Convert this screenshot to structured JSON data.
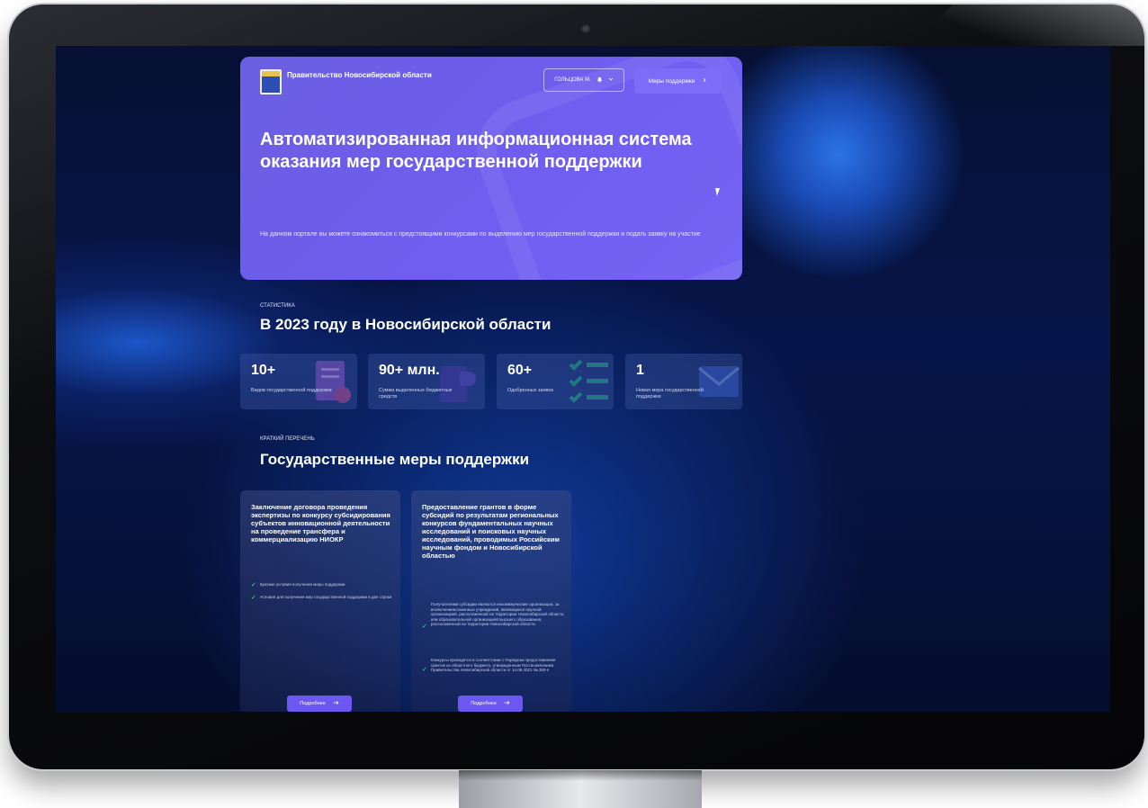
{
  "header": {
    "org_name": "Правительство Новосибирской области",
    "user_label": "ГОЛЬЦОВА М.",
    "measures_button": "Меры поддержки"
  },
  "hero": {
    "title": "Автоматизированная информационная система оказания мер государственной поддержки",
    "description": "На данном портале вы можете ознакомиться с предстоящими конкурсами по выделению мер государственной поддержки и подать заявку на участие"
  },
  "statistics": {
    "kicker": "СТАТИСТИКА",
    "title": "В 2023 году в Новосибирской области",
    "items": [
      {
        "value": "10+",
        "label": "Видов государственной поддержки"
      },
      {
        "value": "90+ млн.",
        "label": "Сумма выделенных бюджетных средств"
      },
      {
        "value": "60+",
        "label": "Одобренных заявок"
      },
      {
        "value": "1",
        "label": "Новая мера государственной поддержки"
      }
    ]
  },
  "measures": {
    "kicker": "КРАТКИЙ ПЕРЕЧЕНЬ",
    "title": "Государственные меры поддержки",
    "cards": [
      {
        "title": "Заключение договора проведения экспертизы по конкурсу субсидирования субъектов инновационной деятельности на проведение трансфера и коммерциализацию НИОКР",
        "items": [
          "Краткие условия получения меры поддержки",
          "Условия для получения мер государственной поддержки в две строки"
        ],
        "button": "Подробнее"
      },
      {
        "title": "Предоставление грантов в форме субсидий по результатам региональных конкурсов фундаментальных научных исследований и поисковых научных исследований, проводимых Российским научным фондом и Новосибирской областью",
        "items": [
          "Получателями субсидии являются некоммерческие организации, за исключением казенных учреждений, являющиеся научной организацией, расположенной на территории Новосибирской области, или образовательной организацией высшего образования, расположенной на территории Новосибирской области",
          "Конкурсы проводятся в соответствии с Порядком предоставления грантов из областного бюджета, утвержденным Постановлением Правительства Новосибирской области от 14.09.2021 № 350-п"
        ],
        "button": "Подробнее"
      }
    ]
  },
  "icons": {
    "user_chevron": "chevron-down-icon",
    "bell": "bell-icon",
    "arrow": "arrow-right-icon",
    "check": "check-icon"
  },
  "colors": {
    "hero_bg": "#6f5ef0",
    "accent_button": "#7d6cf8",
    "card_button": "#6c58f0",
    "check": "#5fd1a7",
    "screen_bg": "#07164a"
  }
}
